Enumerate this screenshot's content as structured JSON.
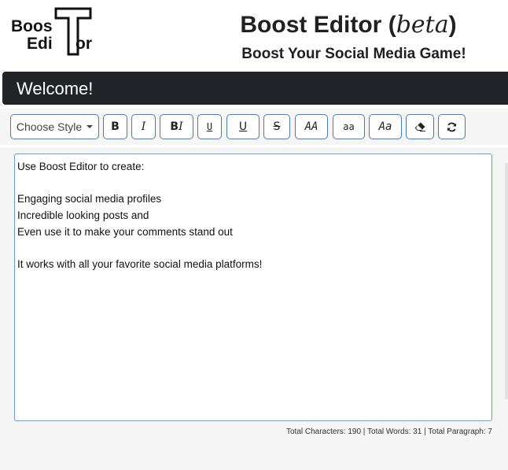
{
  "header": {
    "logo": {
      "line1": "Boos",
      "line2_left": "Edi",
      "line2_right": "or"
    },
    "title": "Boost Editor",
    "title_beta": "beta",
    "subtitle": "Boost Your Social Media Game!"
  },
  "welcome": {
    "text": "Welcome!"
  },
  "toolbar": {
    "style_dropdown": "Choose Style",
    "buttons": [
      {
        "label": "B",
        "icon": "bold"
      },
      {
        "label": "I",
        "icon": "italic"
      },
      {
        "label_b": "B",
        "label_i": "I",
        "icon": "bold-italic"
      },
      {
        "label": "U",
        "icon": "underline-mono"
      },
      {
        "label": "U",
        "icon": "underline"
      },
      {
        "label": "S",
        "icon": "strikethrough"
      },
      {
        "label": "AA",
        "icon": "uppercase"
      },
      {
        "label": "aa",
        "icon": "lowercase"
      },
      {
        "label": "Aa",
        "icon": "capitalize"
      },
      {
        "icon": "eraser-icon"
      },
      {
        "icon": "refresh-icon"
      }
    ]
  },
  "editor": {
    "content": "Use Boost Editor to create:\n\nEngaging social media profiles\nIncredible looking posts and\nEven use it to make your comments stand out\n\nIt works with all your favorite social media platforms!"
  },
  "stats": {
    "text": "Total Characters: 190 | Total Words: 31 | Total Paragraph: 7"
  },
  "colors": {
    "welcome_bg": "#212529",
    "button_border": "#4a7ab8",
    "editor_border": "#6b9bd1"
  }
}
